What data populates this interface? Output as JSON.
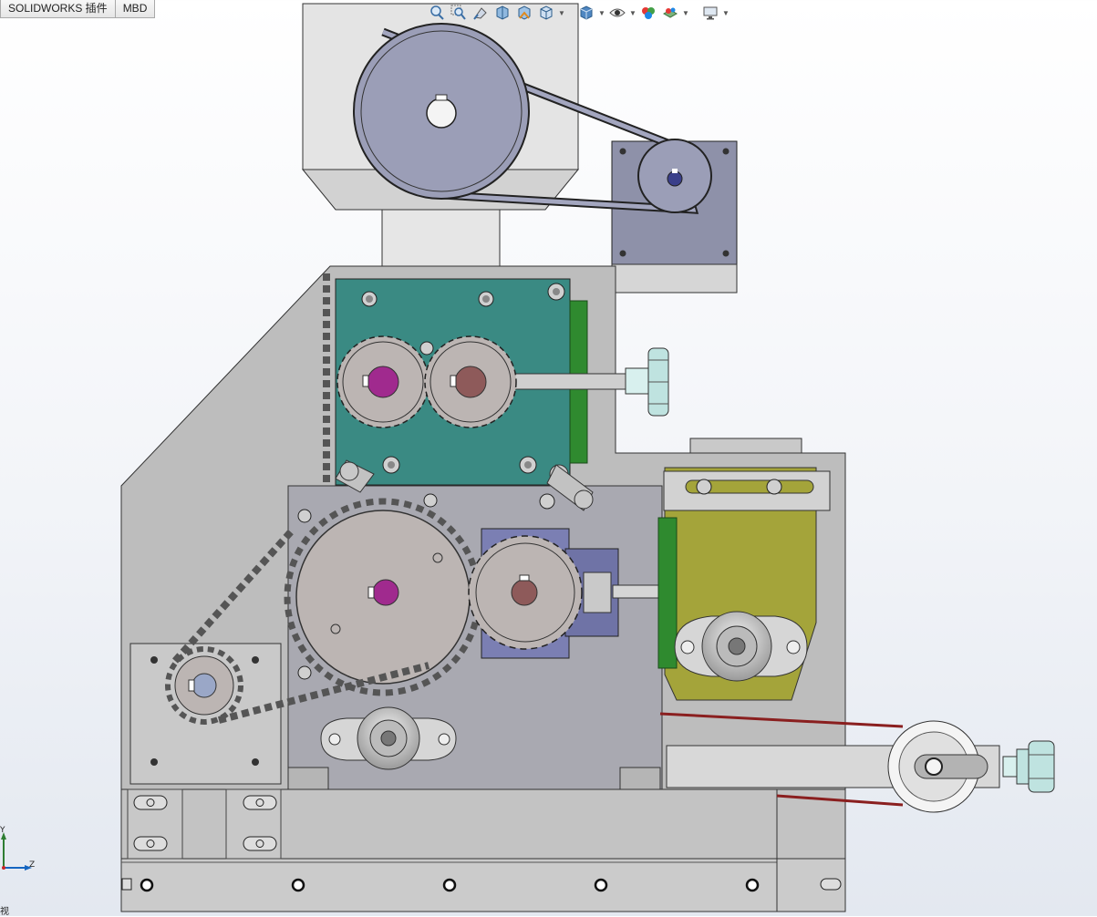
{
  "app": "SOLIDWORKS",
  "tabs": [
    {
      "label": "SOLIDWORKS 插件"
    },
    {
      "label": "MBD"
    }
  ],
  "heads_up_toolbar": [
    {
      "icon": "zoom-to-fit-icon"
    },
    {
      "icon": "zoom-to-area-icon"
    },
    {
      "icon": "previous-view-icon"
    },
    {
      "icon": "section-view-icon"
    },
    {
      "icon": "dynamic-annotation-icon"
    },
    {
      "icon": "view-orientation-icon",
      "dropdown": true
    },
    {
      "icon": "display-style-icon",
      "dropdown": true
    },
    {
      "icon": "hide-show-items-icon",
      "dropdown": true
    },
    {
      "icon": "edit-appearance-icon"
    },
    {
      "icon": "apply-scene-icon",
      "dropdown": true
    },
    {
      "icon": "view-settings-icon",
      "dropdown": true
    }
  ],
  "triad": {
    "y": "Y",
    "z": "Z"
  },
  "view_label": "视",
  "colors": {
    "frame": "#bdbdbd",
    "gearbox_plate": "#3a8a83",
    "bracket_green": "#2f8a2f",
    "olive_plate": "#a4a43a",
    "gear_grey": "#bcb5b3",
    "gear_purple_hub": "#a02a8e",
    "gear_brown_hub": "#8e5a5a",
    "motor_plate": "#8c90a8",
    "knob_cyan": "#bfe3e0",
    "belt_red": "#8a1f1f"
  }
}
